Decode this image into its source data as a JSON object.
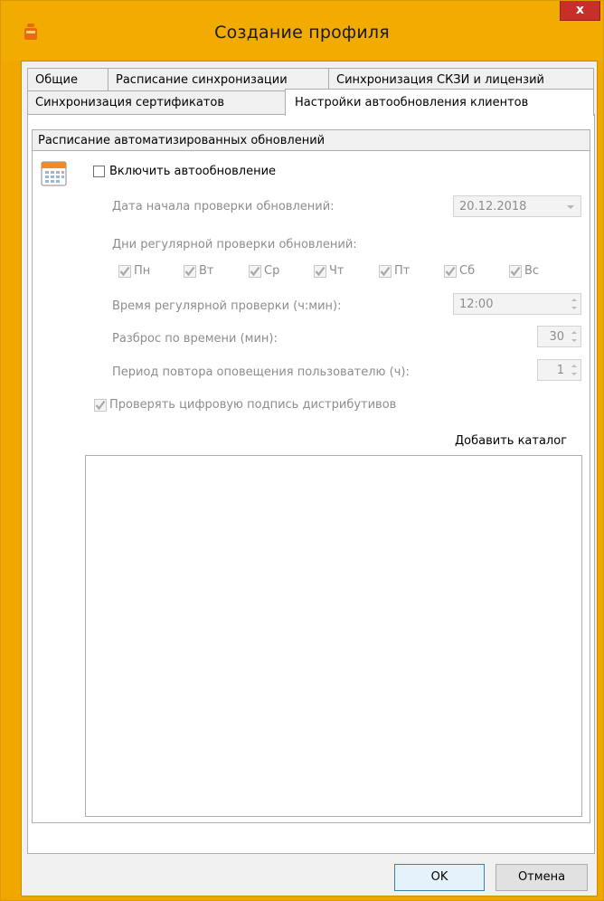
{
  "window": {
    "title": "Создание профиля",
    "close_label": "x"
  },
  "tabs": {
    "row1": [
      "Общие",
      "Расписание синхронизации",
      "Синхронизация СКЗИ и лицензий"
    ],
    "row2": [
      "Синхронизация сертификатов",
      "Настройки автообновления клиентов"
    ]
  },
  "group": {
    "title": "Расписание автоматизированных обновлений"
  },
  "enable": {
    "label": "Включить автообновление",
    "checked": false
  },
  "start_date": {
    "label": "Дата начала проверки обновлений:",
    "value": "20.12.2018"
  },
  "days": {
    "label": "Дни регулярной проверки обновлений:",
    "items": [
      {
        "label": "Пн",
        "checked": true
      },
      {
        "label": "Вт",
        "checked": true
      },
      {
        "label": "Ср",
        "checked": true
      },
      {
        "label": "Чт",
        "checked": true
      },
      {
        "label": "Пт",
        "checked": true
      },
      {
        "label": "Сб",
        "checked": true
      },
      {
        "label": "Вс",
        "checked": true
      }
    ]
  },
  "time": {
    "label": "Время регулярной проверки (ч:мин):",
    "value": "12:00"
  },
  "spread": {
    "label": "Разброс по времени (мин):",
    "value": "30"
  },
  "repeat": {
    "label": "Период повтора оповещения пользователю (ч):",
    "value": "1"
  },
  "verify_signature": {
    "label": "Проверять цифровую подпись дистрибутивов",
    "checked": true
  },
  "add_catalog": {
    "label": "Добавить каталог"
  },
  "buttons": {
    "ok": "OK",
    "cancel": "Отмена"
  },
  "colors": {
    "titlebar": "#f2ab00",
    "close": "#c7302a",
    "disabled_text": "#8d8d8d"
  }
}
